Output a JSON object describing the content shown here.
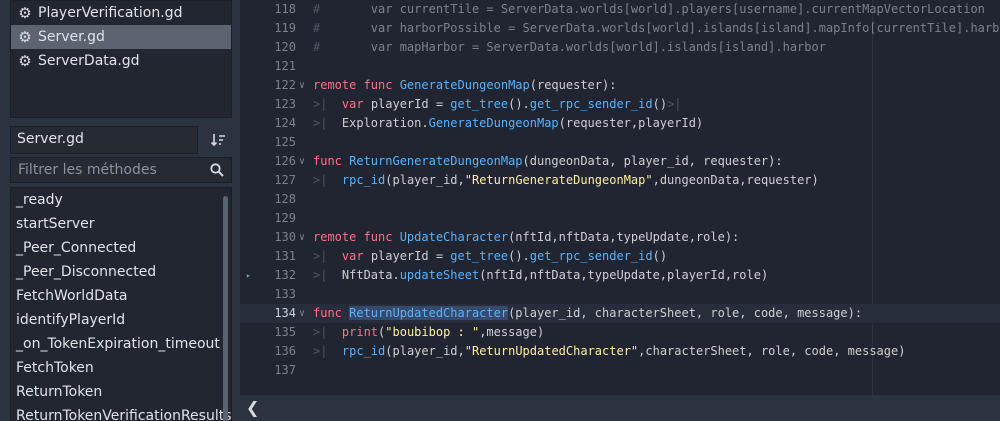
{
  "files": [
    {
      "name": "PlayerVerification.gd",
      "selected": false
    },
    {
      "name": "Server.gd",
      "selected": true
    },
    {
      "name": "ServerData.gd",
      "selected": false
    }
  ],
  "script_name": "Server.gd",
  "filter": {
    "placeholder": "Filtrer les méthodes",
    "value": ""
  },
  "methods": [
    "_ready",
    "startServer",
    "_Peer_Connected",
    "_Peer_Disconnected",
    "FetchWorldData",
    "identifyPlayerId",
    "_on_TokenExpiration_timeout",
    "FetchToken",
    "ReturnToken",
    "ReturnTokenVerificationResults"
  ],
  "code": {
    "current_line": 134,
    "lines": [
      {
        "n": "118",
        "segs": [
          {
            "t": "#\t",
            "c": "sep"
          },
          {
            "t": "var currentTile = ServerData.worlds[world].players[username].currentMapVectorLocation",
            "c": "c"
          }
        ]
      },
      {
        "n": "119",
        "segs": [
          {
            "t": "#\t",
            "c": "sep"
          },
          {
            "t": "var harborPossible = ServerData.worlds[world].islands[island].mapInfo[currentTile].harborPossi",
            "c": "c"
          }
        ]
      },
      {
        "n": "120",
        "segs": [
          {
            "t": "#\t",
            "c": "sep"
          },
          {
            "t": "var mapHarbor = ServerData.worlds[world].islands[island].harbor",
            "c": "c"
          }
        ]
      },
      {
        "n": "121",
        "segs": []
      },
      {
        "n": "122",
        "fold": true,
        "segs": [
          {
            "t": "remote ",
            "c": "k"
          },
          {
            "t": "func ",
            "c": "k"
          },
          {
            "t": "GenerateDungeonMap",
            "c": "fn"
          },
          {
            "t": "(requester):",
            "c": ""
          }
        ]
      },
      {
        "n": "123",
        "segs": [
          {
            "t": ">|  ",
            "c": "sep"
          },
          {
            "t": "var ",
            "c": "k"
          },
          {
            "t": "playerId = ",
            "c": ""
          },
          {
            "t": "get_tree",
            "c": "fn"
          },
          {
            "t": "().",
            "c": ""
          },
          {
            "t": "get_rpc_sender_id",
            "c": "fn"
          },
          {
            "t": "()",
            "c": ""
          },
          {
            "t": ">|",
            "c": "sep"
          }
        ]
      },
      {
        "n": "124",
        "segs": [
          {
            "t": ">|  ",
            "c": "sep"
          },
          {
            "t": "Exploration.",
            "c": ""
          },
          {
            "t": "GenerateDungeonMap",
            "c": "fn"
          },
          {
            "t": "(requester,playerId)",
            "c": ""
          }
        ]
      },
      {
        "n": "125",
        "segs": []
      },
      {
        "n": "126",
        "fold": true,
        "segs": [
          {
            "t": "func ",
            "c": "k"
          },
          {
            "t": "ReturnGenerateDungeonMap",
            "c": "fn"
          },
          {
            "t": "(dungeonData, player_id, requester):",
            "c": ""
          }
        ]
      },
      {
        "n": "127",
        "segs": [
          {
            "t": ">|  ",
            "c": "sep"
          },
          {
            "t": "rpc_id",
            "c": "fn"
          },
          {
            "t": "(player_id,",
            "c": ""
          },
          {
            "t": "\"ReturnGenerateDungeonMap\"",
            "c": "str"
          },
          {
            "t": ",dungeonData,requester)",
            "c": ""
          }
        ]
      },
      {
        "n": "128",
        "segs": []
      },
      {
        "n": "129",
        "segs": []
      },
      {
        "n": "130",
        "fold": true,
        "segs": [
          {
            "t": "remote ",
            "c": "k"
          },
          {
            "t": "func ",
            "c": "k"
          },
          {
            "t": "UpdateCharacter",
            "c": "fn"
          },
          {
            "t": "(nftId,nftData,typeUpdate,role):",
            "c": ""
          }
        ]
      },
      {
        "n": "131",
        "segs": [
          {
            "t": ">|  ",
            "c": "sep"
          },
          {
            "t": "var ",
            "c": "k"
          },
          {
            "t": "playerId = ",
            "c": ""
          },
          {
            "t": "get_tree",
            "c": "fn"
          },
          {
            "t": "().",
            "c": ""
          },
          {
            "t": "get_rpc_sender_id",
            "c": "fn"
          },
          {
            "t": "()",
            "c": ""
          }
        ]
      },
      {
        "n": "132",
        "bp": true,
        "segs": [
          {
            "t": ">|  ",
            "c": "sep"
          },
          {
            "t": "NftData.",
            "c": ""
          },
          {
            "t": "updateSheet",
            "c": "fn"
          },
          {
            "t": "(nftId,nftData,typeUpdate,playerId,role)",
            "c": ""
          }
        ]
      },
      {
        "n": "133",
        "segs": []
      },
      {
        "n": "134",
        "fold": true,
        "segs": [
          {
            "t": "func ",
            "c": "k"
          },
          {
            "t": "ReturnUpdatedCharacter",
            "c": "fn hl"
          },
          {
            "t": "(player_id, characterSheet, role, code, message):",
            "c": ""
          }
        ]
      },
      {
        "n": "135",
        "segs": [
          {
            "t": ">|  ",
            "c": "sep"
          },
          {
            "t": "print",
            "c": "k"
          },
          {
            "t": "(",
            "c": ""
          },
          {
            "t": "\"boubibop : \"",
            "c": "str"
          },
          {
            "t": ",message)",
            "c": ""
          }
        ]
      },
      {
        "n": "136",
        "segs": [
          {
            "t": ">|  ",
            "c": "sep"
          },
          {
            "t": "rpc_id",
            "c": "fn"
          },
          {
            "t": "(player_id,",
            "c": ""
          },
          {
            "t": "\"ReturnUpdatedCharacter\"",
            "c": "str"
          },
          {
            "t": ",characterSheet, role, code, message)",
            "c": ""
          }
        ]
      },
      {
        "n": "137",
        "segs": []
      }
    ]
  },
  "icons": {
    "file": "gear-icon",
    "sort": "sort-icon",
    "search": "search-icon",
    "collapse": "chevron-left-icon",
    "breakpoint": "breakpoint-arrow-icon"
  }
}
